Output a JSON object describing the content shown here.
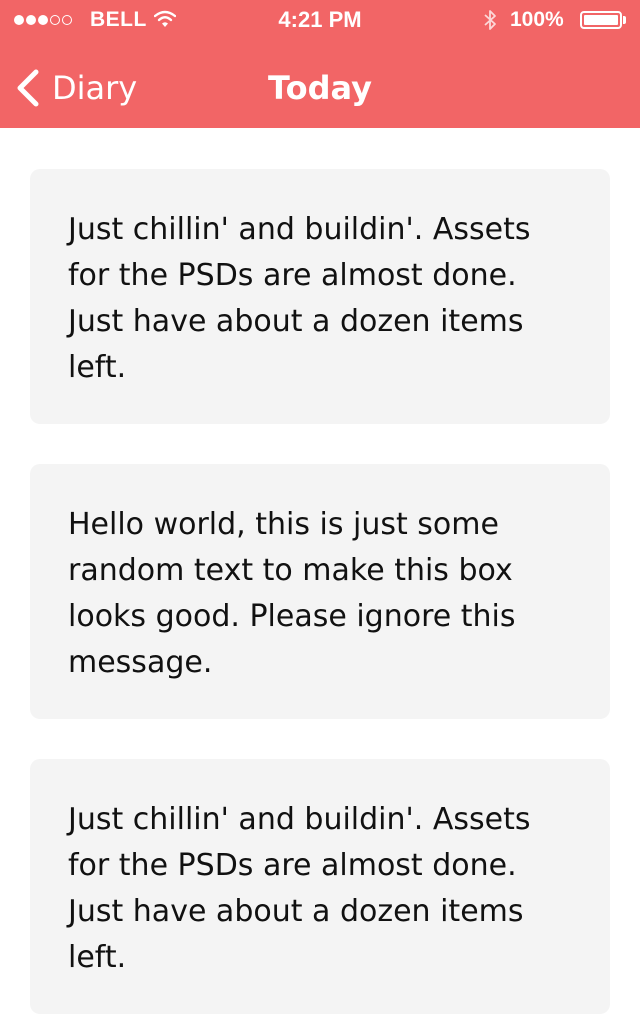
{
  "status_bar": {
    "carrier": "BELL",
    "time": "4:21 PM",
    "battery_percent": "100%",
    "signal_strength": {
      "filled": 3,
      "total": 5
    },
    "icons": [
      "wifi-icon",
      "bluetooth-icon",
      "battery-icon"
    ]
  },
  "nav": {
    "back_label": "Diary",
    "title": "Today"
  },
  "entries": [
    {
      "text": "Just chillin' and buildin'. Assets for the PSDs are almost done. Just have about a dozen items left."
    },
    {
      "text": "Hello world, this is just some random text to make this box looks good. Please ignore this message."
    },
    {
      "text": "Just chillin' and buildin'. Assets for the PSDs are almost done. Just have about a dozen items left."
    }
  ],
  "colors": {
    "header": "#f26566",
    "card_background": "#f4f4f4",
    "text": "#111111"
  }
}
